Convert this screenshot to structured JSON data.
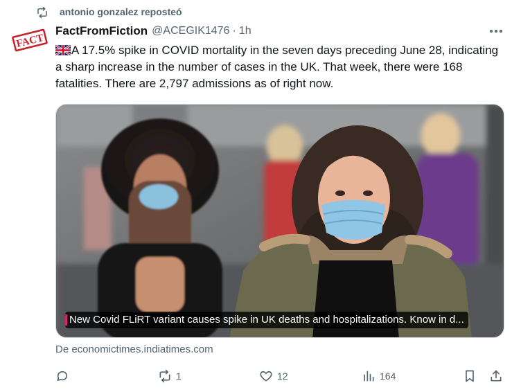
{
  "repost": {
    "text": "antonio gonzalez reposteó",
    "icon": "repost-icon"
  },
  "author": {
    "avatar_label": "FACT",
    "name": "FactFromFiction",
    "handle": "@ACEGIK1476",
    "separator": "·",
    "time": "1h"
  },
  "tweet": {
    "flag_icon": "uk-flag-icon",
    "text": "A 17.5% spike in COVID mortality in the seven days preceding June 28, indicating a sharp increase in the number of cases in the UK. That week, there were 168 fatalities. There are 2,797 admissions as of right now."
  },
  "media": {
    "caption": "New Covid FLiRT variant causes spike in UK deaths and hospitalizations. Know in d...",
    "source": "De economictimes.indiatimes.com"
  },
  "actions": {
    "reply_count": "",
    "repost_count": "1",
    "like_count": "12",
    "views_count": "164"
  },
  "colors": {
    "text_primary": "#0f1419",
    "text_secondary": "#536471",
    "stamp_red": "#c8202a"
  }
}
